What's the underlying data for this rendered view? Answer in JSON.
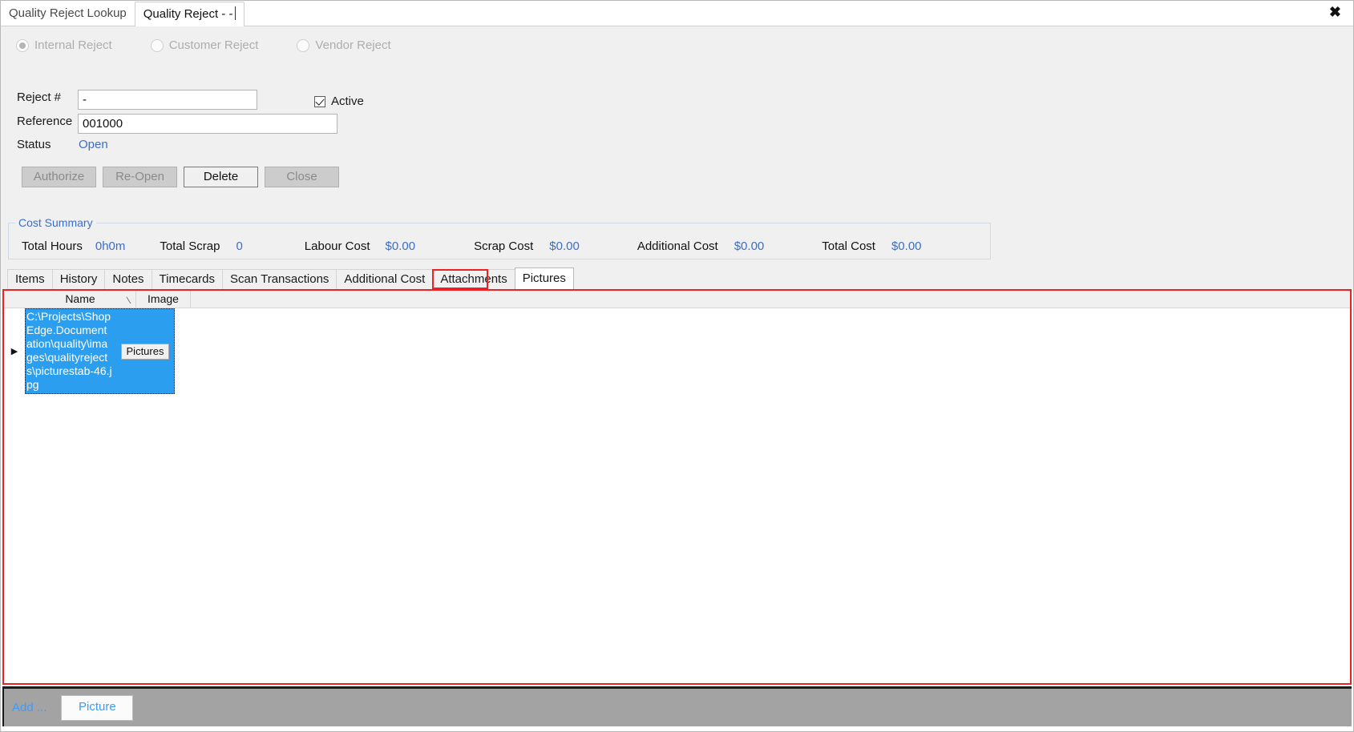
{
  "window": {
    "tabs": [
      {
        "label": "Quality Reject Lookup",
        "active": false
      },
      {
        "label": "Quality Reject - -",
        "active": true
      }
    ],
    "close_icon": "close-icon",
    "close_glyph": "✖"
  },
  "form": {
    "reject_types": [
      {
        "label": "Internal Reject",
        "selected": true
      },
      {
        "label": "Customer Reject",
        "selected": false
      },
      {
        "label": "Vendor Reject",
        "selected": false
      }
    ],
    "reject_number": {
      "label": "Reject #",
      "value": "-"
    },
    "reference": {
      "label": "Reference",
      "value": "001000"
    },
    "status": {
      "label": "Status",
      "value": "Open"
    },
    "active": {
      "label": "Active",
      "checked": true
    },
    "buttons": [
      {
        "label": "Authorize",
        "enabled": false
      },
      {
        "label": "Re-Open",
        "enabled": false
      },
      {
        "label": "Delete",
        "enabled": true
      },
      {
        "label": "Close",
        "enabled": false
      }
    ]
  },
  "cost_summary": {
    "title": "Cost Summary",
    "fields": [
      {
        "label": "Total Hours",
        "value": "0h0m"
      },
      {
        "label": "Total Scrap",
        "value": "0"
      },
      {
        "label": "Labour Cost",
        "value": "$0.00"
      },
      {
        "label": "Scrap Cost",
        "value": "$0.00"
      },
      {
        "label": "Additional Cost",
        "value": "$0.00"
      },
      {
        "label": "Total Cost",
        "value": "$0.00"
      }
    ]
  },
  "detail_tabs": [
    {
      "label": "Items",
      "selected": false
    },
    {
      "label": "History",
      "selected": false
    },
    {
      "label": "Notes",
      "selected": false
    },
    {
      "label": "Timecards",
      "selected": false
    },
    {
      "label": "Scan Transactions",
      "selected": false
    },
    {
      "label": "Additional Cost",
      "selected": false
    },
    {
      "label": "Attachments",
      "selected": false
    },
    {
      "label": "Pictures",
      "selected": true
    }
  ],
  "grid": {
    "columns": [
      {
        "label": "Name",
        "sorted": true,
        "sort_glyph": "∕"
      },
      {
        "label": "Image",
        "sorted": false
      }
    ],
    "rows": [
      {
        "indicator": "▶",
        "name": "C:\\Projects\\ShopEdge.Documentation\\quality\\images\\qualityrejects\\picturestab-46.jpg",
        "image_label": "Pictures",
        "selected": true
      }
    ]
  },
  "bottom_toolbar": {
    "add_label": "Add ...",
    "picture_button": "Picture"
  },
  "colors": {
    "accent_blue": "#3c6fc4",
    "selection_blue": "#2c9eef",
    "highlight_red": "#ed2024",
    "link_blue": "#3f9bf5",
    "panel_grey": "#f0f0f0",
    "toolbar_grey": "#a3a3a3"
  }
}
